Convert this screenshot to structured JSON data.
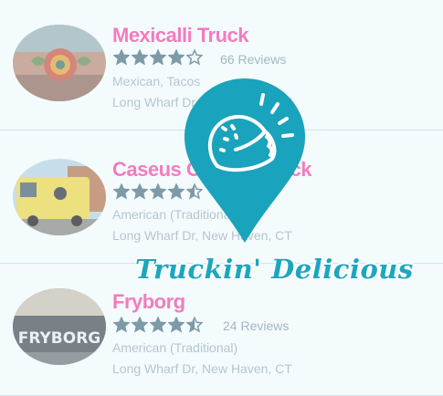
{
  "colors": {
    "name_pink": "#f26fb8",
    "star_gray": "#7e9aa7",
    "meta_gray": "#b5c6ce",
    "brand_teal": "#1ea6be",
    "divider": "#cfe5ee"
  },
  "list": {
    "items": [
      {
        "name": "Mexicalli Truck",
        "rating": 4,
        "rating_max": 5,
        "reviews": "66 Reviews",
        "category": "Mexican, Tacos",
        "address": "Long Wharf Dr, New Haven, CT",
        "image": "food-truck-mural-photo"
      },
      {
        "name": "Caseus Cheese Truck",
        "rating": 4.5,
        "rating_max": 5,
        "reviews": "",
        "category": "American (Traditional)",
        "address": "Long Wharf Dr, New Haven, CT",
        "image": "yellow-truck-photo"
      },
      {
        "name": "Fryborg",
        "rating": 4.5,
        "rating_max": 5,
        "reviews": "24 Reviews",
        "category": "American (Traditional)",
        "address": "Long Wharf Dr, New Haven, CT",
        "image": "fryborg-truck-photo",
        "image_text": "FRYBORG"
      }
    ]
  },
  "logo": {
    "icon": "taco-map-pin-icon",
    "brand": "Truckin' Delicious"
  }
}
